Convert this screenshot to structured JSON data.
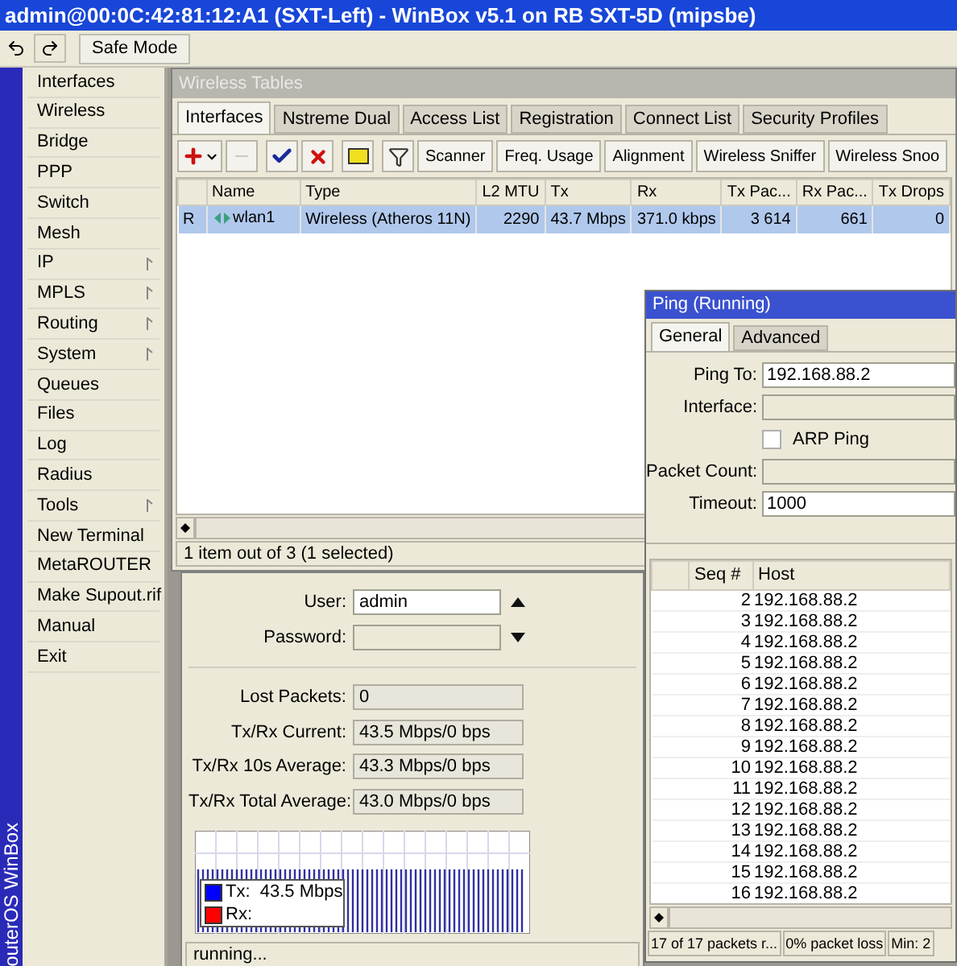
{
  "window": {
    "title": "admin@00:0C:42:81:12:A1 (SXT-Left) - WinBox v5.1 on RB SXT-5D (mipsbe)"
  },
  "toolbar": {
    "safe_mode": "Safe Mode"
  },
  "sidebar": {
    "brand": "outerOS WinBox",
    "items": [
      {
        "label": "Interfaces",
        "submenu": false
      },
      {
        "label": "Wireless",
        "submenu": false
      },
      {
        "label": "Bridge",
        "submenu": false
      },
      {
        "label": "PPP",
        "submenu": false
      },
      {
        "label": "Switch",
        "submenu": false
      },
      {
        "label": "Mesh",
        "submenu": false
      },
      {
        "label": "IP",
        "submenu": true
      },
      {
        "label": "MPLS",
        "submenu": true
      },
      {
        "label": "Routing",
        "submenu": true
      },
      {
        "label": "System",
        "submenu": true
      },
      {
        "label": "Queues",
        "submenu": false
      },
      {
        "label": "Files",
        "submenu": false
      },
      {
        "label": "Log",
        "submenu": false
      },
      {
        "label": "Radius",
        "submenu": false
      },
      {
        "label": "Tools",
        "submenu": true
      },
      {
        "label": "New Terminal",
        "submenu": false
      },
      {
        "label": "MetaROUTER",
        "submenu": false
      },
      {
        "label": "Make Supout.rif",
        "submenu": false
      },
      {
        "label": "Manual",
        "submenu": false
      },
      {
        "label": "Exit",
        "submenu": false
      }
    ]
  },
  "wireless_tables": {
    "title": "Wireless Tables",
    "tabs": [
      {
        "label": "Interfaces",
        "selected": true
      },
      {
        "label": "Nstreme Dual",
        "selected": false
      },
      {
        "label": "Access List",
        "selected": false
      },
      {
        "label": "Registration",
        "selected": false
      },
      {
        "label": "Connect List",
        "selected": false
      },
      {
        "label": "Security Profiles",
        "selected": false
      }
    ],
    "toolbar_buttons": [
      "Scanner",
      "Freq. Usage",
      "Alignment",
      "Wireless Sniffer",
      "Wireless Snoo"
    ],
    "columns": [
      "Name",
      "Type",
      "L2 MTU",
      "Tx",
      "Rx",
      "Tx Pac...",
      "Rx Pac...",
      "Tx Drops"
    ],
    "rows": [
      {
        "selected": true,
        "flag": "R",
        "cells": [
          "wlan1",
          "Wireless (Atheros 11N)",
          "2290",
          "43.7 Mbps",
          "371.0 kbps",
          "3 614",
          "661",
          "0"
        ]
      }
    ],
    "status": "1 item out of 3 (1 selected)"
  },
  "bandwidth_test": {
    "fields": [
      {
        "kind": "input",
        "label": "User:",
        "value": "admin",
        "disabled": false,
        "arrow_up": true
      },
      {
        "kind": "input",
        "label": "Password:",
        "disabled": true,
        "arrow_down": true
      },
      {
        "kind": "readout",
        "label": "Lost Packets:",
        "value": "0"
      },
      {
        "kind": "readout",
        "label": "Tx/Rx Current:",
        "value": "43.5 Mbps/0 bps"
      },
      {
        "kind": "readout",
        "label": "Tx/Rx 10s Average:",
        "value": "43.3 Mbps/0 bps"
      },
      {
        "kind": "readout",
        "label": "Tx/Rx Total Average:",
        "value": "43.0 Mbps/0 bps"
      }
    ],
    "legend": [
      {
        "label": "Tx:  43.5 Mbps",
        "color": "#0000ff"
      },
      {
        "label": "Rx:",
        "color": "#ff0000"
      }
    ],
    "status": "running..."
  },
  "ping": {
    "title": "Ping (Running)",
    "tabs": [
      {
        "label": "General",
        "selected": true
      },
      {
        "label": "Advanced",
        "selected": false
      }
    ],
    "fields": [
      {
        "kind": "input",
        "label": "Ping To:",
        "value": "192.168.88.2",
        "disabled": false
      },
      {
        "kind": "input",
        "label": "Interface:",
        "disabled": true
      },
      {
        "kind": "checkbox",
        "label": "ARP Ping",
        "checked": false
      },
      {
        "kind": "input",
        "label": "Packet Count:",
        "disabled": true
      },
      {
        "kind": "input",
        "label": "Timeout:",
        "value": "1000",
        "disabled": false
      }
    ],
    "columns": [
      "Seq #",
      "Host"
    ],
    "rows": [
      {
        "seq": "2",
        "host": "192.168.88.2"
      },
      {
        "seq": "3",
        "host": "192.168.88.2"
      },
      {
        "seq": "4",
        "host": "192.168.88.2"
      },
      {
        "seq": "5",
        "host": "192.168.88.2"
      },
      {
        "seq": "6",
        "host": "192.168.88.2"
      },
      {
        "seq": "7",
        "host": "192.168.88.2"
      },
      {
        "seq": "8",
        "host": "192.168.88.2"
      },
      {
        "seq": "9",
        "host": "192.168.88.2"
      },
      {
        "seq": "10",
        "host": "192.168.88.2"
      },
      {
        "seq": "11",
        "host": "192.168.88.2"
      },
      {
        "seq": "12",
        "host": "192.168.88.2"
      },
      {
        "seq": "13",
        "host": "192.168.88.2"
      },
      {
        "seq": "14",
        "host": "192.168.88.2"
      },
      {
        "seq": "15",
        "host": "192.168.88.2"
      },
      {
        "seq": "16",
        "host": "192.168.88.2"
      }
    ],
    "status": [
      "17 of 17 packets r...",
      "0% packet loss",
      "Min: 2"
    ]
  }
}
